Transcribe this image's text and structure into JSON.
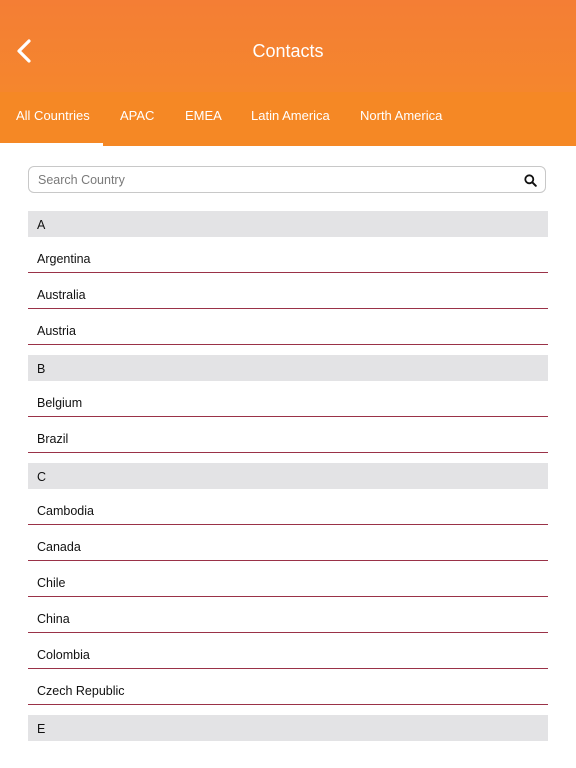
{
  "header": {
    "title": "Contacts"
  },
  "tabs": [
    {
      "label": "All Countries",
      "selected": true
    },
    {
      "label": "APAC",
      "selected": false
    },
    {
      "label": "EMEA",
      "selected": false
    },
    {
      "label": "Latin America",
      "selected": false
    },
    {
      "label": "North America",
      "selected": false
    }
  ],
  "search": {
    "placeholder": "Search Country",
    "value": ""
  },
  "sections": [
    {
      "letter": "A",
      "items": [
        "Argentina",
        "Australia",
        "Austria"
      ]
    },
    {
      "letter": "B",
      "items": [
        "Belgium",
        "Brazil"
      ]
    },
    {
      "letter": "C",
      "items": [
        "Cambodia",
        "Canada",
        "Chile",
        "China",
        "Colombia",
        "Czech Republic"
      ]
    },
    {
      "letter": "E",
      "items": []
    }
  ],
  "icons": {
    "back": "chevron-left-icon",
    "search": "search-icon"
  },
  "colors": {
    "header": "#f47e35",
    "tabs": "#f58825",
    "section_header": "#e3e3e5",
    "divider": "#9a3248"
  }
}
